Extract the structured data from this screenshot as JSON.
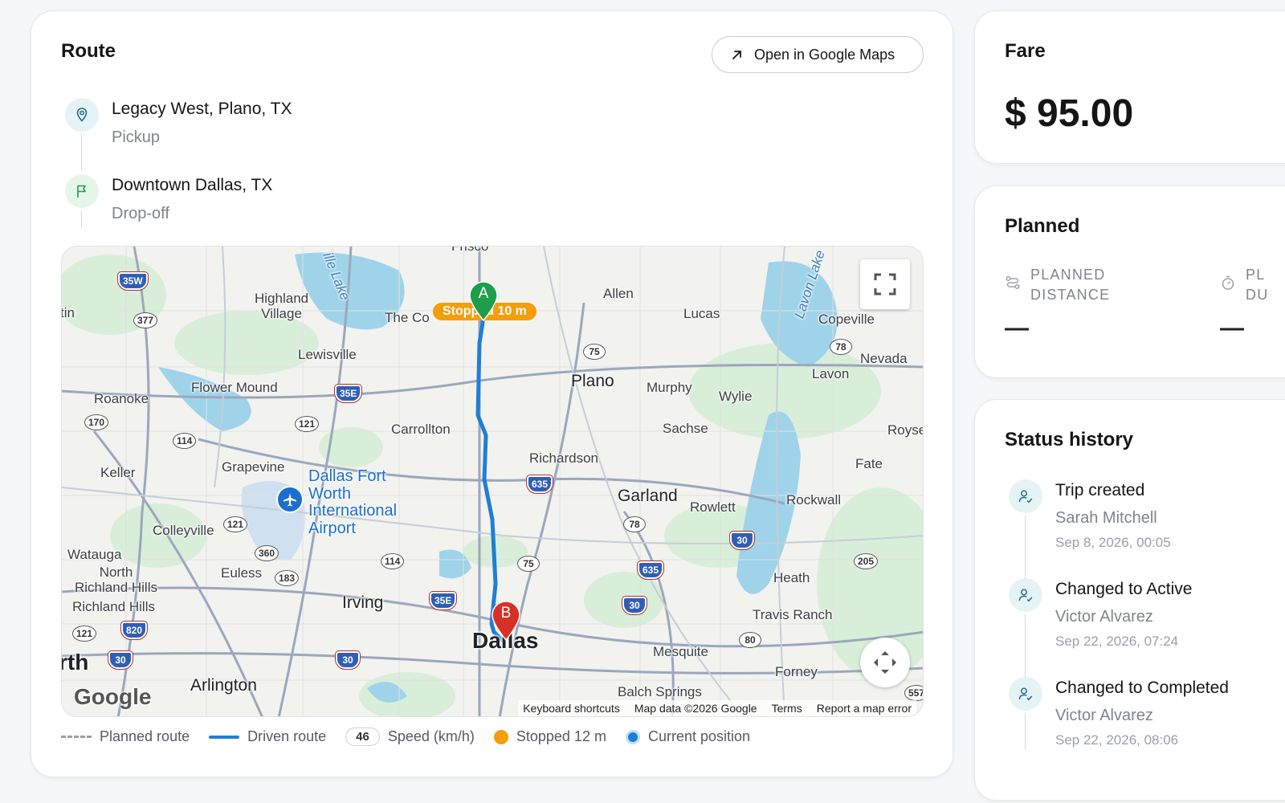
{
  "route": {
    "title": "Route",
    "open_maps_label": "Open in Google Maps",
    "pickup": {
      "name": "Legacy West, Plano, TX",
      "role": "Pickup"
    },
    "dropoff": {
      "name": "Downtown Dallas, TX",
      "role": "Drop-off"
    },
    "map": {
      "stopped_pill": "Stopped 10 m",
      "marker_a": "A",
      "marker_b": "B",
      "google": "Google",
      "footer": {
        "shortcuts": "Keyboard shortcuts",
        "map_data": "Map data ©2026 Google",
        "terms": "Terms",
        "report": "Report a map error"
      },
      "labels": {
        "frisco": "Frisco",
        "highland": "Highland\nVillage",
        "colony": "The Co",
        "allen": "Allen",
        "lucas": "Lucas",
        "copeville": "Copeville",
        "lewisville": "Lewisville",
        "plano": "Plano",
        "murphy": "Murphy",
        "wylie": "Wylie",
        "lavon": "Lavon",
        "nevada": "Nevada",
        "roanoke": "Roanoke",
        "flower_mound": "Flower Mound",
        "carrollton": "Carrollton",
        "sachse": "Sachse",
        "royse": "Royse",
        "keller": "Keller",
        "grapevine": "Grapevine",
        "airport": "Dallas Fort\nWorth\nInternational\nAirport",
        "richardson": "Richardson",
        "garland": "Garland",
        "rowlett": "Rowlett",
        "rockwall": "Rockwall",
        "fate": "Fate",
        "colleyville": "Colleyville",
        "watauga": "Watauga",
        "nrh": "North\nRichland Hills",
        "rh": "Richland Hills",
        "euless": "Euless",
        "irving": "Irving",
        "heath": "Heath",
        "travis_ranch": "Travis Ranch",
        "dallas": "Dallas",
        "mesquite": "Mesquite",
        "forney": "Forney",
        "arlington": "Arlington",
        "balch": "Balch Springs",
        "fort_worth_tail": "rth",
        "austin_tail": "tin",
        "lewisville_lake": "ille Lake",
        "lavon_lake": "Lavon Lake"
      },
      "shields": {
        "i35w": "35W",
        "us377": "377",
        "sh121a": "121",
        "i35e_n": "35E",
        "us75_n": "75",
        "sh78_n": "78",
        "sh170": "170",
        "sh114_n": "114",
        "i635_n": "635",
        "sh121b": "121",
        "sh78_s": "78",
        "sh360": "360",
        "sh183": "183",
        "sh114_s": "114",
        "us75_s": "75",
        "i635_s": "635",
        "i30_e": "30",
        "sh205": "205",
        "i35e_s": "35E",
        "i30_m": "30",
        "sh121c": "121",
        "i820": "820",
        "i30_w": "30",
        "i30_c": "30",
        "us80": "80",
        "us557": "557"
      }
    },
    "legend": {
      "planned": "Planned route",
      "driven": "Driven route",
      "speed_badge": "46",
      "speed": "Speed (km/h)",
      "stopped": "Stopped 12 m",
      "current": "Current position"
    }
  },
  "fare": {
    "title": "Fare",
    "amount": "$ 95.00"
  },
  "planned": {
    "title": "Planned",
    "distance_label": "PLANNED\nDISTANCE",
    "distance_value": "—",
    "duration_label": "PL\nDU",
    "duration_value": "—"
  },
  "status": {
    "title": "Status history",
    "items": [
      {
        "title": "Trip created",
        "user": "Sarah Mitchell",
        "time": "Sep 8, 2026, 00:05"
      },
      {
        "title": "Changed to Active",
        "user": "Victor Alvarez",
        "time": "Sep 22, 2026, 07:24"
      },
      {
        "title": "Changed to Completed",
        "user": "Victor Alvarez",
        "time": "Sep 22, 2026, 08:06"
      }
    ]
  },
  "colors": {
    "driven_route": "#1f7fd4",
    "stopped": "#f59e0b",
    "marker_a": "#1e9e4a",
    "marker_b": "#d93025",
    "current_position": "#1a7fd6"
  }
}
